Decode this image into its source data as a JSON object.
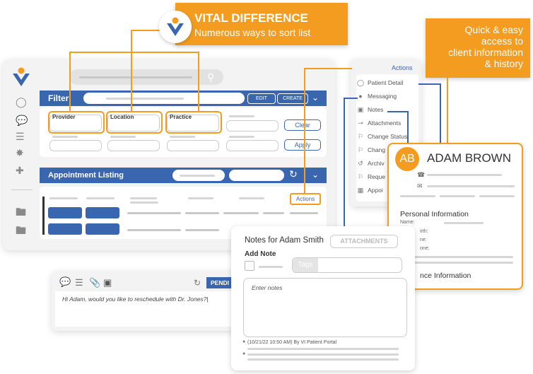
{
  "callouts": {
    "vital_title": "VITAL DIFFERENCE",
    "vital_sub": "Numerous ways to sort list",
    "quick_lines": [
      "Quick & easy",
      "access to",
      "client information",
      "& history"
    ]
  },
  "main": {
    "filter_label": "Filter",
    "edit_label": "EDIT",
    "create_label": "CREATE",
    "fields": {
      "provider": "Provider",
      "location": "Location",
      "practice": "Practice"
    },
    "clear_label": "Clear",
    "apply_label": "Apply",
    "appointment_label": "Appointment Listing",
    "actions_label": "Actions"
  },
  "actions_menu": {
    "title": "Actions",
    "items": [
      "Patient Detail",
      "Messaging",
      "Notes",
      "Attachments",
      "Change Status",
      "Chang",
      "Archiv",
      "Reque",
      "Appoi"
    ]
  },
  "patient_card": {
    "initials": "AB",
    "name": "ADAM BROWN",
    "personal_info": "Personal Information",
    "name_label": "Name:",
    "field_frags": [
      "irth:",
      "ne:",
      "one:"
    ],
    "insurance_frag": "nce Information"
  },
  "notes": {
    "title": "Notes for Adam Smith",
    "attachments_label": "ATTACHMENTS",
    "add_note": "Add Note",
    "tags_label": "Tags",
    "placeholder": "Enter notes",
    "entry": "(10/21/22 10:50 AM) By VI Patient Portal"
  },
  "message": {
    "status_label": "PENDI",
    "text": "Hi Adam, would you like to reschedule with Dr. Jones?|"
  },
  "colors": {
    "accent": "#f39c1f",
    "brand_blue": "#3a66b0"
  }
}
